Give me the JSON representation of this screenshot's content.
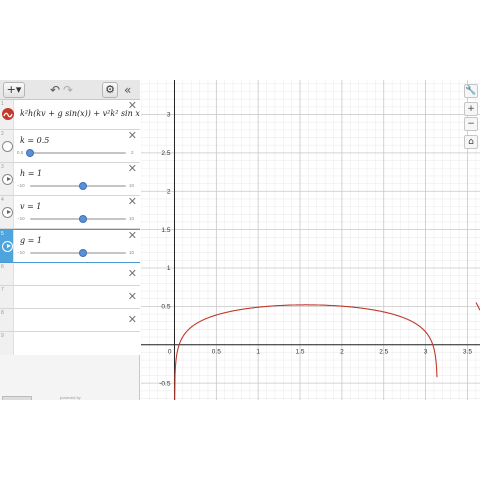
{
  "toolbar": {
    "add_label": "+▾",
    "undo_label": "↶",
    "redo_label": "↷",
    "settings_label": "⚙",
    "collapse_label": "«"
  },
  "expressions": [
    {
      "index": "1",
      "type": "function",
      "latex_text": "k²h(kv + g sin(x)) + v²k² sin x",
      "color": "#c0392b"
    },
    {
      "index": "2",
      "type": "slider",
      "text": "k = 0.5",
      "variable": "k",
      "value": 0.5,
      "min_label": "0.5",
      "max_label": "2",
      "min": 0.5,
      "max": 2
    },
    {
      "index": "3",
      "type": "slider",
      "text": "h = 1",
      "variable": "h",
      "value": 1,
      "min_label": "−10",
      "max_label": "10",
      "min": -10,
      "max": 10
    },
    {
      "index": "4",
      "type": "slider",
      "text": "v = 1",
      "variable": "v",
      "value": 1,
      "min_label": "−10",
      "max_label": "10",
      "min": -10,
      "max": 10
    },
    {
      "index": "5",
      "type": "slider",
      "text": "g = 1",
      "variable": "g",
      "value": 1,
      "min_label": "−10",
      "max_label": "10",
      "min": -10,
      "max": 10
    },
    {
      "index": "6",
      "type": "empty"
    },
    {
      "index": "7",
      "type": "empty"
    },
    {
      "index": "8",
      "type": "empty"
    },
    {
      "index": "9",
      "type": "empty"
    }
  ],
  "footer": {
    "powered_text": "powered by"
  },
  "graph": {
    "xlim": [
      -0.4,
      3.65
    ],
    "ylim": [
      -0.72,
      3.45
    ],
    "x_tick_labels": [
      "0",
      "0.5",
      "1",
      "1.5",
      "2",
      "2.5",
      "3",
      "3.5"
    ],
    "x_tick_values": [
      0,
      0.5,
      1,
      1.5,
      2,
      2.5,
      3,
      3.5
    ],
    "y_tick_labels": [
      "3",
      "2.5",
      "2",
      "1.5",
      "1",
      "0.5",
      "-0.5"
    ],
    "y_tick_values": [
      3,
      2.5,
      2,
      1.5,
      1,
      0.5,
      -0.5
    ],
    "curve_color": "#c0392b",
    "grid": true
  },
  "zoom": {
    "wrench_label": "🔧",
    "plus_label": "+",
    "minus_label": "−",
    "home_label": "⌂"
  }
}
